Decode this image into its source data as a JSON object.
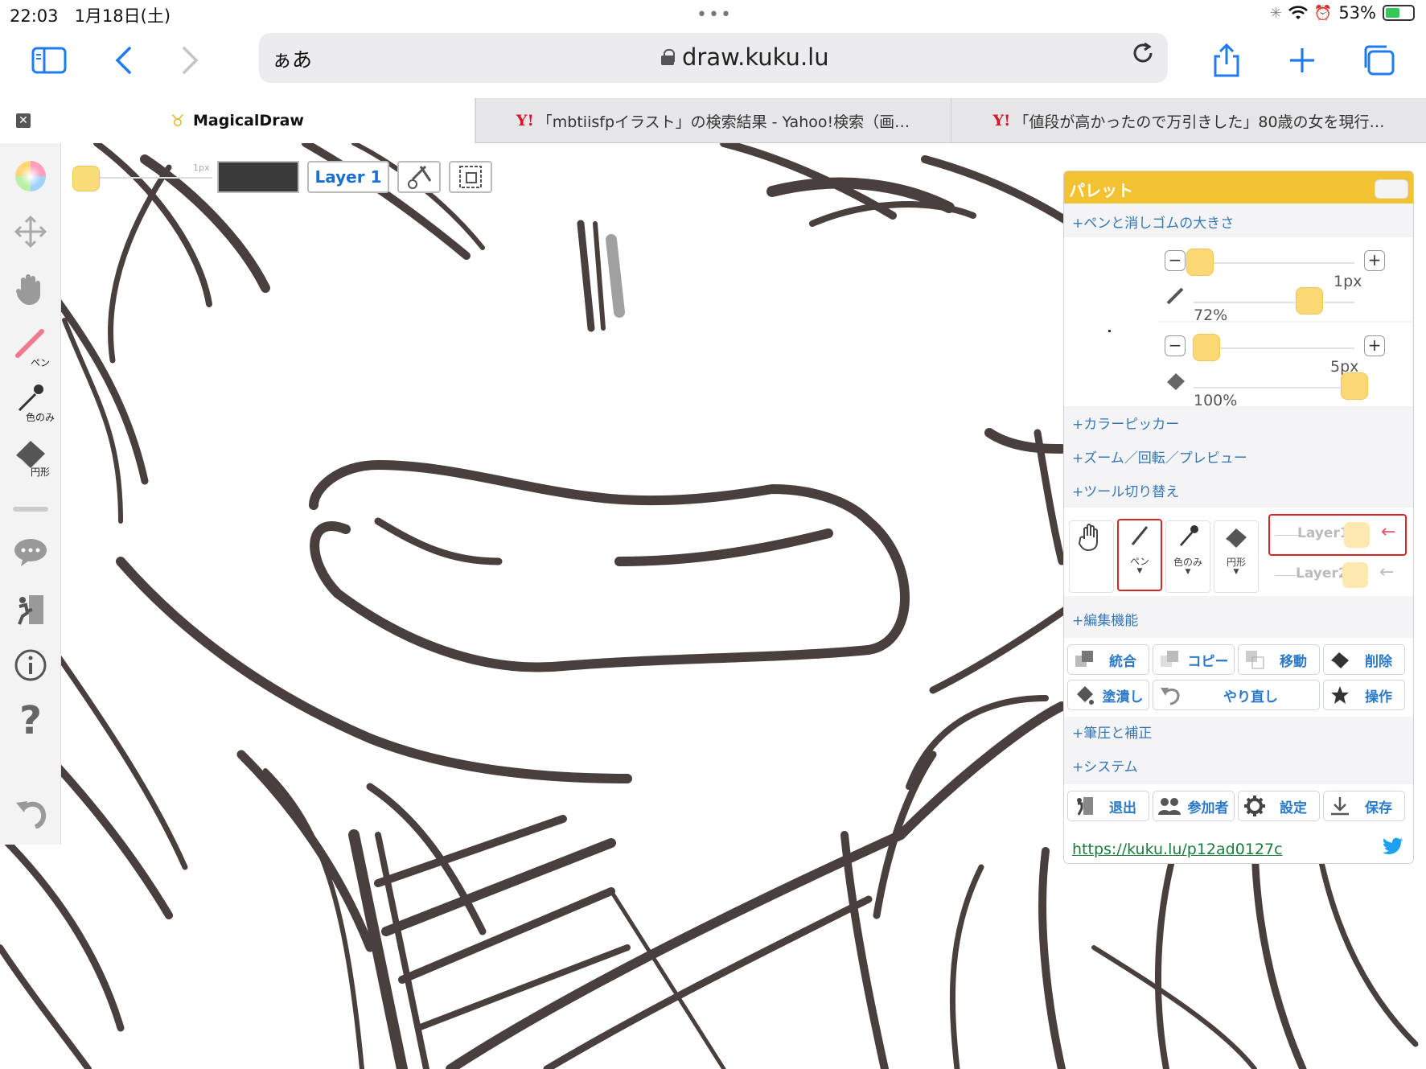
{
  "status_bar": {
    "time": "22:03",
    "date": "1月18日(土)",
    "battery": "53%",
    "battery_level": 0.53
  },
  "browser": {
    "aa_label": "ぁあ",
    "url": "draw.kuku.lu",
    "tabs": [
      {
        "title": "MagicalDraw",
        "active": true
      },
      {
        "title": "「mbtiisfpイラスト」の検索結果 - Yahoo!検索（画…",
        "active": false,
        "logo": "Y!"
      },
      {
        "title": "「値段が高かったので万引きした」80歳の女を現行…",
        "active": false,
        "logo": "Y!"
      }
    ]
  },
  "left_toolbar": {
    "pen_label": "ペン",
    "eyedropper_label": "色のみ",
    "eraser_label": "円形"
  },
  "canvas_toolbar": {
    "layer_label": "Layer 1",
    "size_tag": "1px"
  },
  "palette": {
    "title": "パレット",
    "sections": {
      "pen_eraser_size": "+ペンと消しゴムの大きさ",
      "color_picker": "+カラーピッカー",
      "zoom": "+ズーム／回転／プレビュー",
      "tool_switch": "+ツール切り替え",
      "edit": "+編集機能",
      "pressure": "+筆圧と補正",
      "system": "+システム"
    },
    "pen": {
      "size": "1px",
      "opacity": "72%",
      "size_level": 0.04,
      "opacity_level": 0.72
    },
    "eraser": {
      "size": "5px",
      "opacity": "100%",
      "size_level": 0.08,
      "opacity_level": 1.0
    },
    "tools": [
      {
        "label": "",
        "icon": "hand-icon"
      },
      {
        "label": "ペン",
        "icon": "pen-icon"
      },
      {
        "label": "色のみ",
        "icon": "eyedropper-icon"
      },
      {
        "label": "円形",
        "icon": "eraser-icon"
      }
    ],
    "layers": [
      "Layer1",
      "Layer2"
    ],
    "edit_buttons": [
      "統合",
      "コピー",
      "移動",
      "削除",
      "塗潰し",
      "やり直し",
      "操作"
    ],
    "system_buttons": [
      "退出",
      "参加者",
      "設定",
      "保存"
    ],
    "share_url": "https://kuku.lu/p12ad0127c"
  },
  "colors": {
    "accent": "#f2c233",
    "link": "#2b7ac9",
    "brush_swatch": "#fadd78",
    "ios_blue": "#1f7bf0"
  }
}
